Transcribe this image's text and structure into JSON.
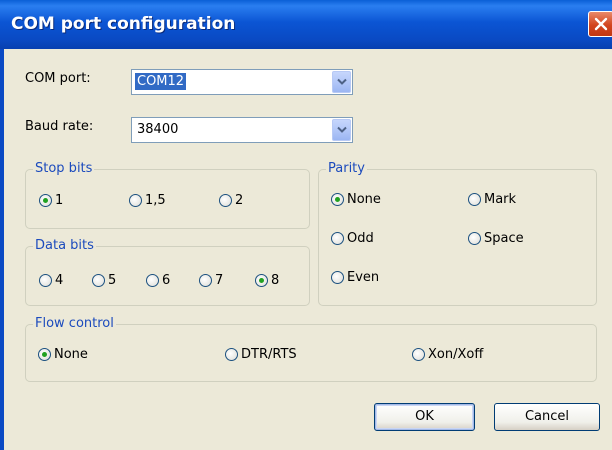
{
  "window": {
    "title": "COM port configuration"
  },
  "com_port": {
    "label": "COM port:",
    "value": "COM12"
  },
  "baud_rate": {
    "label": "Baud rate:",
    "value": "38400"
  },
  "stop_bits": {
    "legend": "Stop bits",
    "options": [
      {
        "label": "1",
        "checked": true
      },
      {
        "label": "1,5",
        "checked": false
      },
      {
        "label": "2",
        "checked": false
      }
    ]
  },
  "data_bits": {
    "legend": "Data bits",
    "options": [
      {
        "label": "4",
        "checked": false
      },
      {
        "label": "5",
        "checked": false
      },
      {
        "label": "6",
        "checked": false
      },
      {
        "label": "7",
        "checked": false
      },
      {
        "label": "8",
        "checked": true
      }
    ]
  },
  "parity": {
    "legend": "Parity",
    "options": [
      {
        "label": "None",
        "checked": true
      },
      {
        "label": "Mark",
        "checked": false
      },
      {
        "label": "Odd",
        "checked": false
      },
      {
        "label": "Space",
        "checked": false
      },
      {
        "label": "Even",
        "checked": false
      }
    ]
  },
  "flow_control": {
    "legend": "Flow control",
    "options": [
      {
        "label": "None",
        "checked": true
      },
      {
        "label": "DTR/RTS",
        "checked": false
      },
      {
        "label": "Xon/Xoff",
        "checked": false
      }
    ]
  },
  "buttons": {
    "ok": "OK",
    "cancel": "Cancel"
  },
  "colors": {
    "titlebar": "#0a4ac4",
    "dialog_bg": "#ece9d8",
    "legend_text": "#1c4bbd",
    "selection": "#316ac5"
  }
}
